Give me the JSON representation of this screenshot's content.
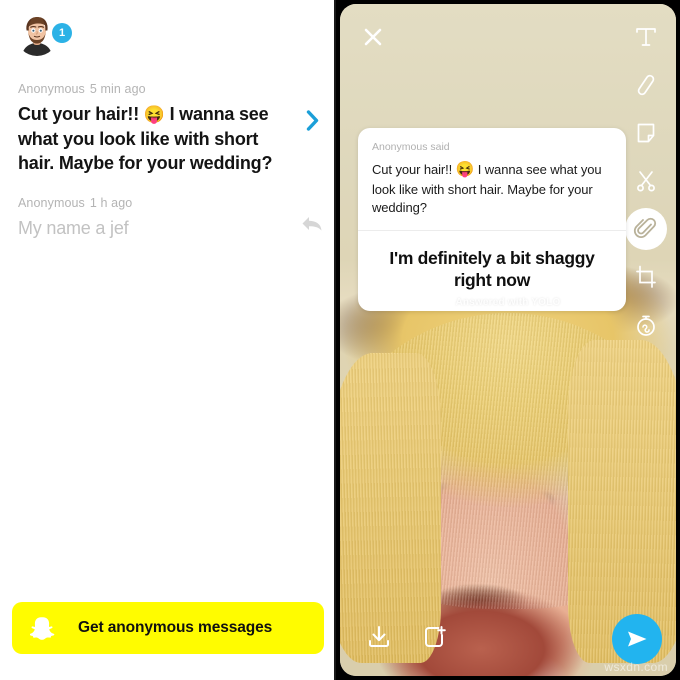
{
  "inbox": {
    "avatar": {
      "name": "bitmoji-avatar",
      "unread_badge": "1"
    },
    "messages": [
      {
        "sender": "Anonymous",
        "time": "5 min ago",
        "text_before_emoji": "Cut your hair!! ",
        "emoji": "😝",
        "text_after_emoji": " I wanna see what you look like with short hair. Maybe for your wedding?",
        "state": "unread",
        "action_icon": "chevron-right-icon"
      },
      {
        "sender": "Anonymous",
        "time": "1 h ago",
        "text_before_emoji": "My name a jef",
        "emoji": "",
        "text_after_emoji": "",
        "state": "read",
        "action_icon": "reply-arrow-icon"
      }
    ],
    "cta": {
      "icon": "snapchat-ghost-icon",
      "label": "Get anonymous messages",
      "background_color": "#fffc00",
      "text_color": "#101010"
    }
  },
  "editor": {
    "close_icon": "close-icon",
    "tools": [
      {
        "icon": "text-tool-icon",
        "label": "T",
        "active": false
      },
      {
        "icon": "pencil-draw-icon",
        "label": "Draw",
        "active": false
      },
      {
        "icon": "sticker-icon",
        "label": "Stickers",
        "active": false
      },
      {
        "icon": "scissors-icon",
        "label": "Scissors",
        "active": false
      },
      {
        "icon": "paperclip-icon",
        "label": "Attach link",
        "active": true
      },
      {
        "icon": "crop-icon",
        "label": "Crop",
        "active": false
      },
      {
        "icon": "timer-icon",
        "label": "Timer",
        "active": false
      }
    ],
    "card": {
      "said_label": "Anonymous said",
      "question_before_emoji": "Cut your hair!! ",
      "question_emoji": "😝",
      "question_after_emoji": " I wanna see what you look like with short hair. Maybe for your wedding?",
      "answer": "I'm definitely a bit shaggy right now"
    },
    "answered_with": "Answered with YOLO",
    "bottom_actions": [
      {
        "icon": "download-icon",
        "label": "Save"
      },
      {
        "icon": "add-to-story-icon",
        "label": "Add to story"
      }
    ],
    "send": {
      "icon": "send-plane-icon",
      "label": "Send",
      "color": "#22b4ef"
    },
    "watermark": "wsxdn.com"
  }
}
